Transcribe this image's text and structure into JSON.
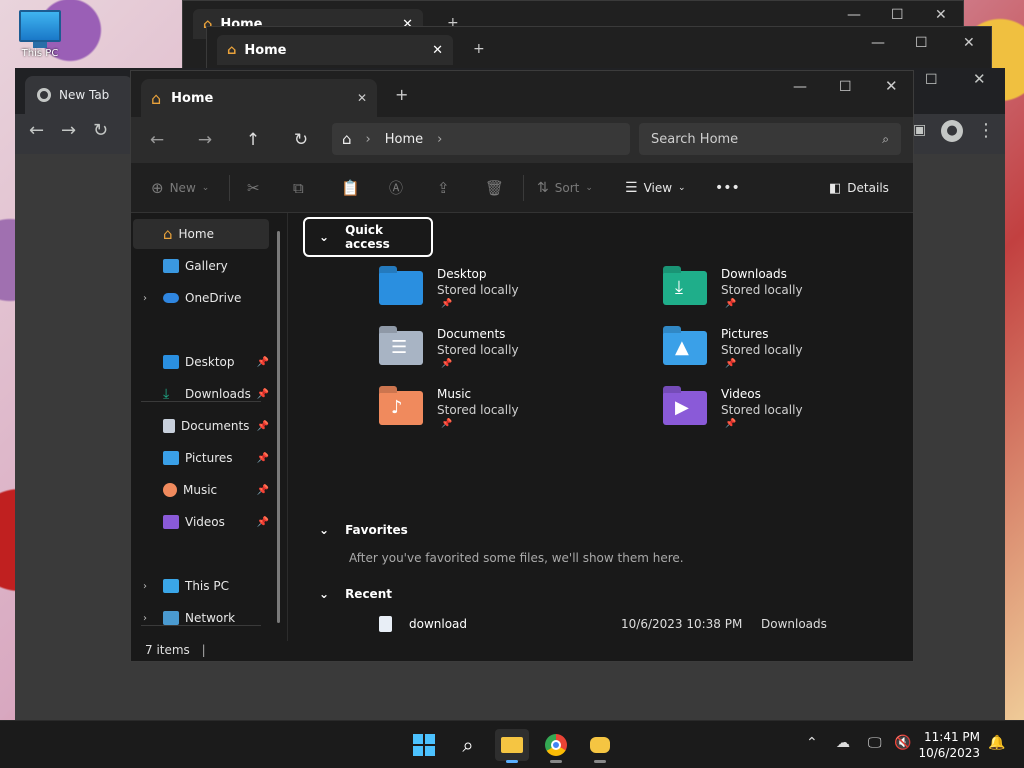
{
  "desktop": {
    "icon_label": "This PC"
  },
  "bg_windows": [
    {
      "tab_title": "Home"
    },
    {
      "tab_title": "Home"
    }
  ],
  "chrome": {
    "tab_title": "New Tab"
  },
  "explorer": {
    "tab_title": "Home",
    "new_tab_glyph": "+",
    "breadcrumb": "Home",
    "search_placeholder": "Search Home",
    "toolbar": {
      "new": "New",
      "sort": "Sort",
      "view": "View",
      "more": "•••",
      "details": "Details"
    },
    "sidebar": {
      "home": "Home",
      "gallery": "Gallery",
      "onedrive": "OneDrive",
      "pinned": [
        "Desktop",
        "Downloads",
        "Documents",
        "Pictures",
        "Music",
        "Videos"
      ],
      "thispc": "This PC",
      "network": "Network"
    },
    "quick_access": {
      "title": "Quick access",
      "items": [
        {
          "name": "Desktop",
          "sub": "Stored locally"
        },
        {
          "name": "Downloads",
          "sub": "Stored locally"
        },
        {
          "name": "Documents",
          "sub": "Stored locally"
        },
        {
          "name": "Pictures",
          "sub": "Stored locally"
        },
        {
          "name": "Music",
          "sub": "Stored locally"
        },
        {
          "name": "Videos",
          "sub": "Stored locally"
        }
      ]
    },
    "favorites": {
      "title": "Favorites",
      "empty": "After you've favorited some files, we'll show them here."
    },
    "recent": {
      "title": "Recent",
      "rows": [
        {
          "name": "download",
          "date": "10/6/2023 10:38 PM",
          "location": "Downloads"
        }
      ]
    },
    "status": "7 items"
  },
  "taskbar": {
    "time": "11:41 PM",
    "date": "10/6/2023"
  },
  "colors": {
    "accent": "#5ab0ff",
    "folder_desktop": "#2a8fe0",
    "folder_downloads": "#1fae8a",
    "folder_music": "#f08a5d",
    "folder_videos": "#8a5ad8"
  }
}
